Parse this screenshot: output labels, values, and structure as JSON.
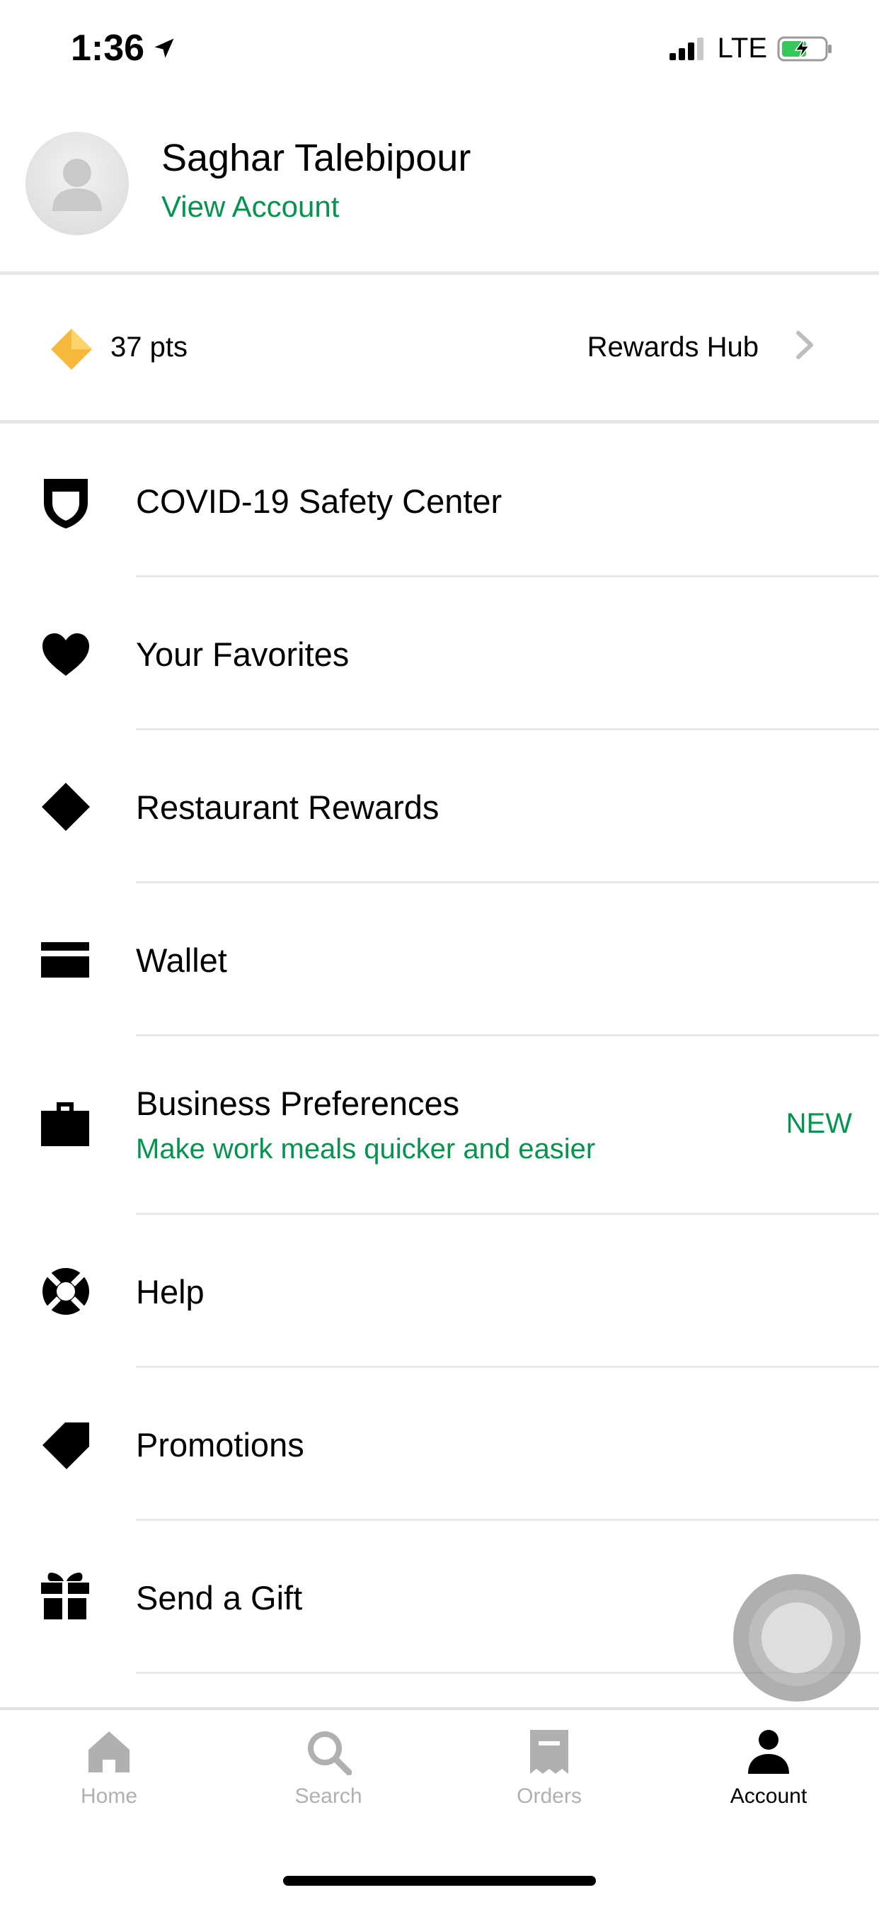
{
  "status_bar": {
    "time": "1:36",
    "network": "LTE"
  },
  "profile": {
    "name": "Saghar Talebipour",
    "view_account": "View Account"
  },
  "rewards": {
    "points": "37 pts",
    "hub_label": "Rewards Hub"
  },
  "menu": {
    "covid": {
      "label": "COVID-19 Safety Center",
      "icon": "shield-icon"
    },
    "favorites": {
      "label": "Your Favorites",
      "icon": "heart-icon"
    },
    "restaurant_rewards": {
      "label": "Restaurant Rewards",
      "icon": "diamond-icon"
    },
    "wallet": {
      "label": "Wallet",
      "icon": "wallet-icon"
    },
    "business": {
      "label": "Business Preferences",
      "subtitle": "Make work meals quicker and easier",
      "badge": "NEW",
      "icon": "briefcase-icon"
    },
    "help": {
      "label": "Help",
      "icon": "lifebuoy-icon"
    },
    "promotions": {
      "label": "Promotions",
      "icon": "tag-icon"
    },
    "gift": {
      "label": "Send a Gift",
      "icon": "gift-icon"
    }
  },
  "tabs": {
    "home": "Home",
    "search": "Search",
    "orders": "Orders",
    "account": "Account",
    "active": "Account"
  },
  "colors": {
    "accent": "#05944f",
    "rewards_gold": "#f6b93b",
    "battery_green": "#34c759"
  }
}
